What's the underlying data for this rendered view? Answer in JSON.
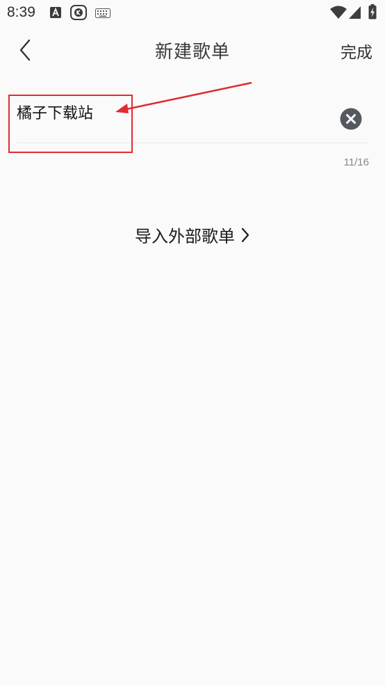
{
  "status_bar": {
    "time": "8:39",
    "icons": [
      "a-notification-icon",
      "app-notification-icon",
      "keyboard-icon",
      "wifi-icon",
      "signal-icon",
      "battery-charging-icon"
    ]
  },
  "nav": {
    "back_icon": "chevron-left-icon",
    "title": "新建歌单",
    "done_label": "完成"
  },
  "form": {
    "name_value": "橘子下载站",
    "clear_icon": "close-circle-icon",
    "char_count": "11/16"
  },
  "import": {
    "label": "导入外部歌单",
    "icon": "chevron-right-icon"
  },
  "annotation": {
    "color": "#e02b2f"
  },
  "colors": {
    "background": "#fafafb",
    "clear_icon_bg": "#55595f"
  }
}
